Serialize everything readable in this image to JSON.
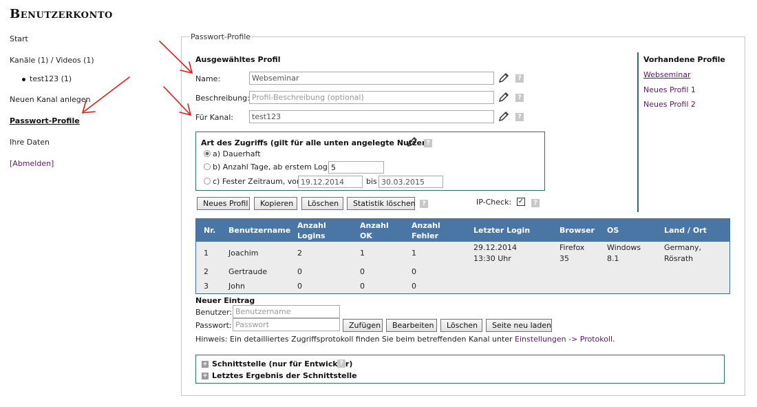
{
  "page": {
    "title": "Benutzerkonto"
  },
  "nav": {
    "start": "Start",
    "channels": "Kanäle (1) / Videos (1)",
    "channel_item": "test123 (1)",
    "new_channel": "Neuen Kanal anlegen",
    "password_profiles": "Passwort-Profile",
    "your_data": "Ihre Daten",
    "logout": "[Abmelden]"
  },
  "panel": {
    "legend": "Passwort-Profile",
    "selected_profile_heading": "Ausgewähltes Profil",
    "name_label": "Name:",
    "name_value": "Webseminar",
    "description_label": "Beschreibung:",
    "description_placeholder": "Profil-Beschreibung (optional)",
    "channel_label": "Für Kanal:",
    "channel_value": "test123",
    "help": "?"
  },
  "access": {
    "heading": "Art des Zugriffs (gilt für alle unten angelegte Nutzer)",
    "option_a": "a) Dauerhaft",
    "option_b": "b) Anzahl Tage, ab erstem Login",
    "option_b_value": "5",
    "option_c": "c) Fester Zeitraum, vom",
    "option_c_from": "19.12.2014",
    "option_c_until_label": "bis",
    "option_c_to": "30.03.2015",
    "selected": "a"
  },
  "actions": {
    "new_profile": "Neues Profil",
    "copy": "Kopieren",
    "delete": "Löschen",
    "clear_stats": "Statistik löschen",
    "ip_check_label": "IP-Check:",
    "ip_check_checked": true
  },
  "existing_profiles": {
    "heading": "Vorhandene Profile",
    "items": [
      "Webseminar",
      "Neues Profil 1",
      "Neues Profil 2"
    ]
  },
  "table": {
    "headers": {
      "nr": "Nr.",
      "username": "Benutzername",
      "logins_1": "Anzahl",
      "logins_2": "Logins",
      "ok_1": "Anzahl",
      "ok_2": "OK",
      "errors_1": "Anzahl",
      "errors_2": "Fehler",
      "last_login": "Letzter Login",
      "browser": "Browser",
      "os": "OS",
      "country": "Land / Ort"
    },
    "rows": [
      {
        "nr": "1",
        "username": "Joachim",
        "logins": "2",
        "ok": "1",
        "errors": "1",
        "last_login_date": "29.12.2014",
        "last_login_time": "13:30 Uhr",
        "browser_1": "Firefox",
        "browser_2": "35",
        "os_1": "Windows",
        "os_2": "8.1",
        "country_1": "Germany,",
        "country_2": "Rösrath"
      },
      {
        "nr": "2",
        "username": "Gertraude",
        "logins": "0",
        "ok": "0",
        "errors": "0"
      },
      {
        "nr": "3",
        "username": "John",
        "logins": "0",
        "ok": "0",
        "errors": "0"
      }
    ]
  },
  "new_entry": {
    "heading": "Neuer Eintrag",
    "user_label": "Benutzer:",
    "user_placeholder": "Benutzername",
    "password_label": "Passwort:",
    "password_placeholder": "Passwort",
    "add": "Zufügen",
    "edit": "Bearbeiten",
    "delete": "Löschen",
    "reload": "Seite neu laden",
    "hint_prefix": "Hinweis: Ein detailliertes Zugriffsprotokoll finden Sie beim betreffenden Kanal unter",
    "hint_link": "Einstellungen -> Protokoll",
    "hint_suffix": "."
  },
  "developer": {
    "interface": "Schnittstelle (nur für Entwickler)",
    "last_result": "Letztes Ergebnis der Schnittstelle",
    "plus": "+"
  },
  "colors": {
    "table_header": "#4a76a6",
    "box_border": "#2f6b6b",
    "link": "#5a1766",
    "annotation_arrow": "#e31b1b"
  },
  "icons": {
    "edit": "pencil-icon",
    "help": "help-icon",
    "bullet": "bullet-icon",
    "expand": "plus-icon"
  }
}
